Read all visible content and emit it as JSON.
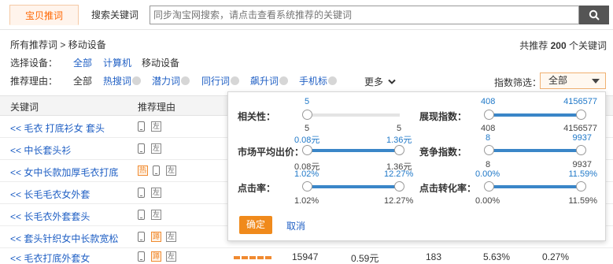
{
  "tabs": {
    "active": "宝贝推词",
    "other": "搜索关键词"
  },
  "search": {
    "placeholder": "同步淘宝网搜索，请点击查看系统推荐的关键词",
    "icon": "search-icon"
  },
  "breadcrumb": {
    "root": "所有推荐词",
    "sep": ">",
    "current": "移动设备"
  },
  "total": {
    "prefix": "共推荐",
    "count": "200",
    "suffix": "个关键词"
  },
  "device": {
    "label": "选择设备：",
    "options": [
      "全部",
      "计算机",
      "移动设备"
    ]
  },
  "reason": {
    "label": "推荐理由：",
    "options": [
      "全部",
      "热搜词",
      "潜力词",
      "同行词",
      "飙升词",
      "手机标"
    ],
    "more": "更多"
  },
  "index_filter": {
    "label": "指数筛选：",
    "selected": "全部"
  },
  "table": {
    "headers": {
      "keyword": "关键词",
      "reason": "推荐理由"
    },
    "rows": [
      {
        "keyword": "<< 毛衣 打底衫女 套头",
        "tags": [
          "phone",
          "左"
        ]
      },
      {
        "keyword": "<< 中长套头衫",
        "tags": [
          "phone",
          "左"
        ]
      },
      {
        "keyword": "<< 女中长款加厚毛衣打底",
        "tags": [
          "热",
          "phone",
          "左"
        ]
      },
      {
        "keyword": "<< 长毛毛衣女外套",
        "tags": [
          "phone",
          "左"
        ]
      },
      {
        "keyword": "<< 长毛衣外套套头",
        "tags": [
          "phone",
          "左"
        ]
      },
      {
        "keyword": "<< 套头针织女中长款宽松",
        "tags": [
          "phone",
          "蹲",
          "左"
        ]
      },
      {
        "keyword": "<< 毛衣打底外套女",
        "tags": [
          "phone",
          "蹲",
          "左"
        ],
        "values": [
          "15947",
          "0.59元",
          "183",
          "5.63%",
          "0.27%"
        ]
      }
    ]
  },
  "popup": {
    "relevance": {
      "label": "相关性：",
      "top": "5",
      "min": "5",
      "max": "5"
    },
    "display_index": {
      "label": "展现指数：",
      "top_min": "408",
      "top_max": "4156577",
      "min": "408",
      "max": "4156577"
    },
    "avg_bid": {
      "label": "市场平均出价：",
      "top_min": "0.08元",
      "top_max": "1.36元",
      "min": "0.08元",
      "max": "1.36元"
    },
    "competition": {
      "label": "竞争指数：",
      "top_min": "8",
      "top_max": "9937",
      "min": "8",
      "max": "9937"
    },
    "ctr": {
      "label": "点击率：",
      "top_min": "1.02%",
      "top_max": "12.27%",
      "min": "1.02%",
      "max": "12.27%"
    },
    "cvr": {
      "label": "点击转化率：",
      "top_min": "0.00%",
      "top_max": "11.59%",
      "min": "0.00%",
      "max": "11.59%"
    },
    "confirm": "确定",
    "cancel": "取消"
  },
  "colors": {
    "accent": "#f08a1c",
    "link": "#1f5fc4",
    "slider": "#3a86c8"
  }
}
